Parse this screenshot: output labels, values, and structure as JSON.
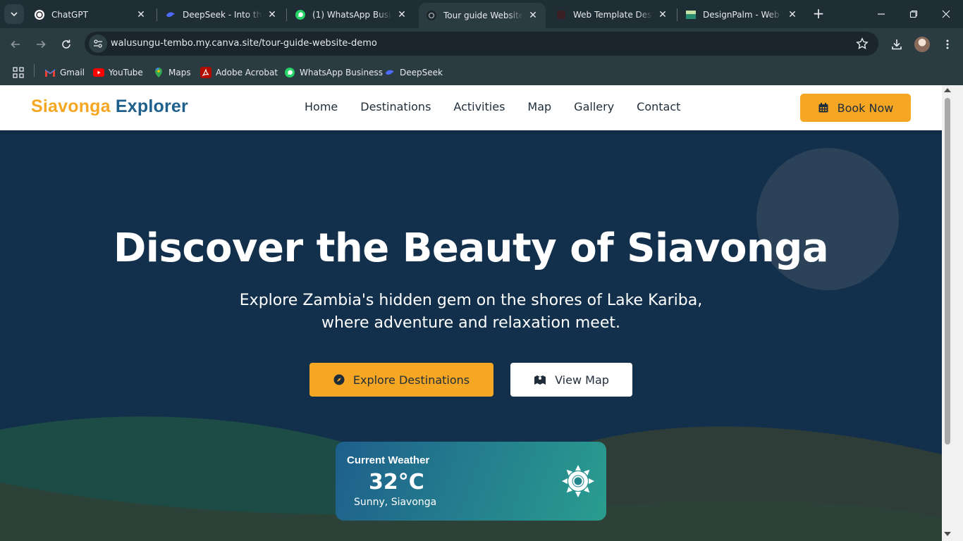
{
  "browser": {
    "tabs": [
      {
        "title": "ChatGPT",
        "icon": "chatgpt-icon"
      },
      {
        "title": "DeepSeek - Into the Unknown",
        "icon": "deepseek-icon"
      },
      {
        "title": "(1) WhatsApp Business",
        "icon": "whatsapp-icon"
      },
      {
        "title": "Tour guide Website demo",
        "icon": "canva-icon",
        "active": true
      },
      {
        "title": "Web Template Design",
        "icon": "template-icon"
      },
      {
        "title": "DesignPalm - Web Design",
        "icon": "designpalm-icon"
      }
    ],
    "url": "walusungu-tembo.my.canva.site/tour-guide-website-demo",
    "bookmarks": [
      {
        "label": "Gmail",
        "icon": "gmail-icon"
      },
      {
        "label": "YouTube",
        "icon": "youtube-icon"
      },
      {
        "label": "Maps",
        "icon": "maps-icon"
      },
      {
        "label": "Adobe Acrobat",
        "icon": "acrobat-icon"
      },
      {
        "label": "WhatsApp Business",
        "icon": "whatsapp-icon"
      },
      {
        "label": "DeepSeek",
        "icon": "deepseek-icon"
      }
    ]
  },
  "site": {
    "logo_part1": "Siavonga",
    "logo_part2": "Explorer",
    "nav": [
      "Home",
      "Destinations",
      "Activities",
      "Map",
      "Gallery",
      "Contact"
    ],
    "book_label": "Book Now",
    "colors": {
      "accent": "#f5a623",
      "brand": "#1e5f8c",
      "hero_bg": "#12304b"
    }
  },
  "hero": {
    "title": "Discover the Beauty of Siavonga",
    "subtitle_line1": "Explore Zambia's hidden gem on the shores of Lake Kariba,",
    "subtitle_line2": "where adventure and relaxation meet.",
    "primary_cta": "Explore Destinations",
    "secondary_cta": "View Map"
  },
  "weather": {
    "label": "Current Weather",
    "temp": "32°C",
    "desc": "Sunny, Siavonga",
    "icon": "sun-icon"
  }
}
